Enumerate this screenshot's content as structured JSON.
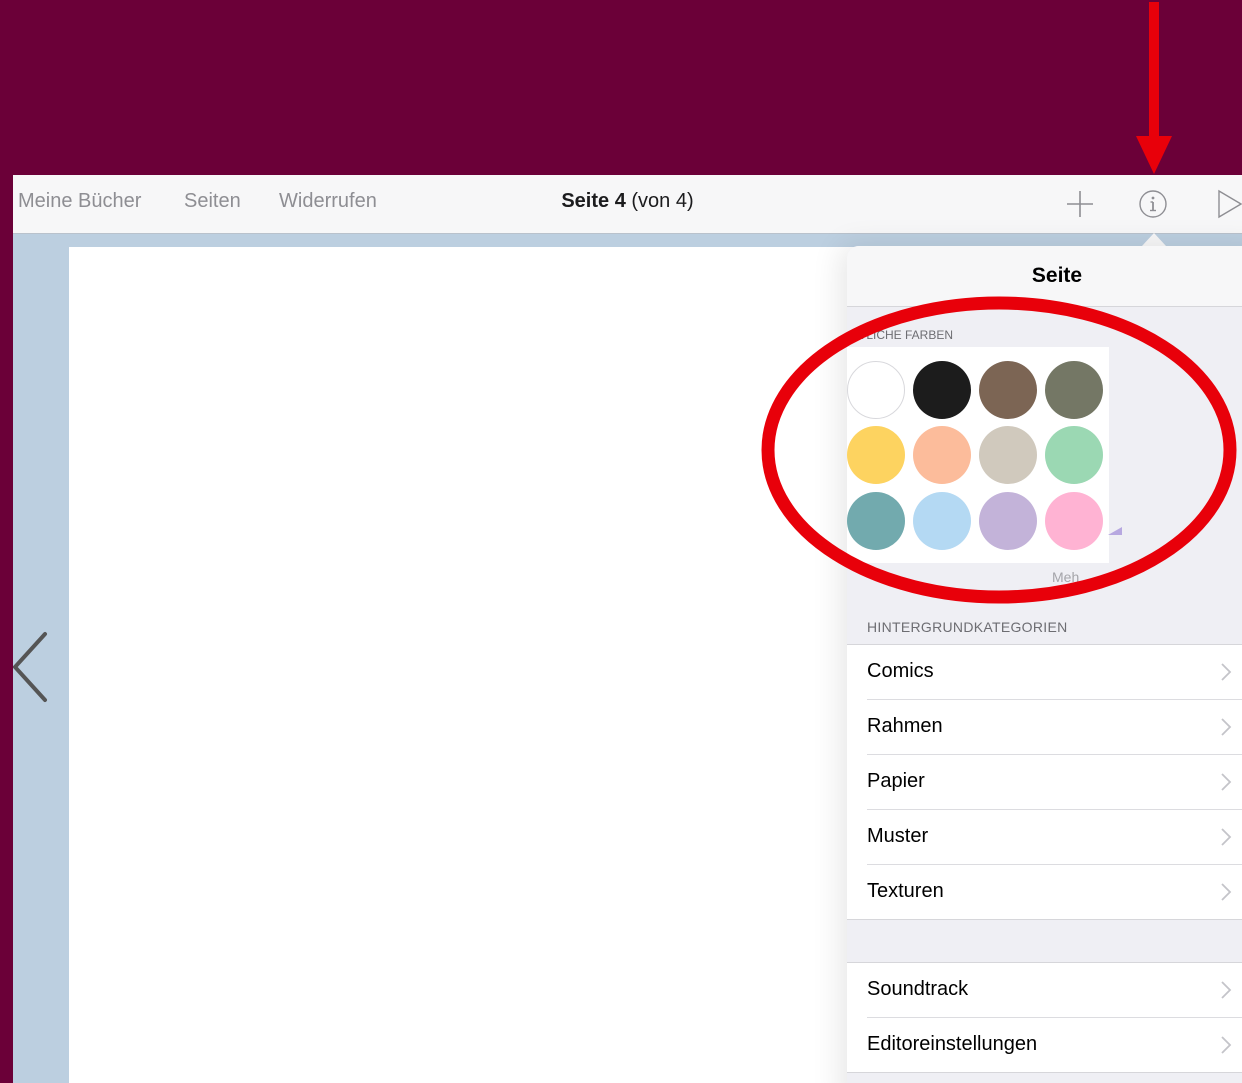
{
  "toolbar": {
    "my_books": "Meine Bücher",
    "pages": "Seiten",
    "undo": "Widerrufen",
    "title_bold": "Seite 4",
    "title_rest": "(von 4)",
    "add_icon": "plus-icon",
    "info_icon": "info-icon",
    "play_icon": "play-icon"
  },
  "popover": {
    "title": "Seite",
    "colors_section": "…TLICHE FARBEN",
    "colors": [
      "#ffffff",
      "#1c1c1c",
      "#7c6554",
      "#747765",
      "#fdd360",
      "#fcbc9b",
      "#d0c9bd",
      "#9bd8b3",
      "#72aaae",
      "#b4d9f3",
      "#c3b3d9",
      "#ffb3d3"
    ],
    "more_label": "Meh",
    "categories_label": "HINTERGRUNDKATEGORIEN",
    "categories": [
      "Comics",
      "Rahmen",
      "Papier",
      "Muster",
      "Texturen"
    ],
    "other": [
      "Soundtrack",
      "Editoreinstellungen"
    ]
  },
  "annotation": {
    "color": "#e8000a"
  }
}
